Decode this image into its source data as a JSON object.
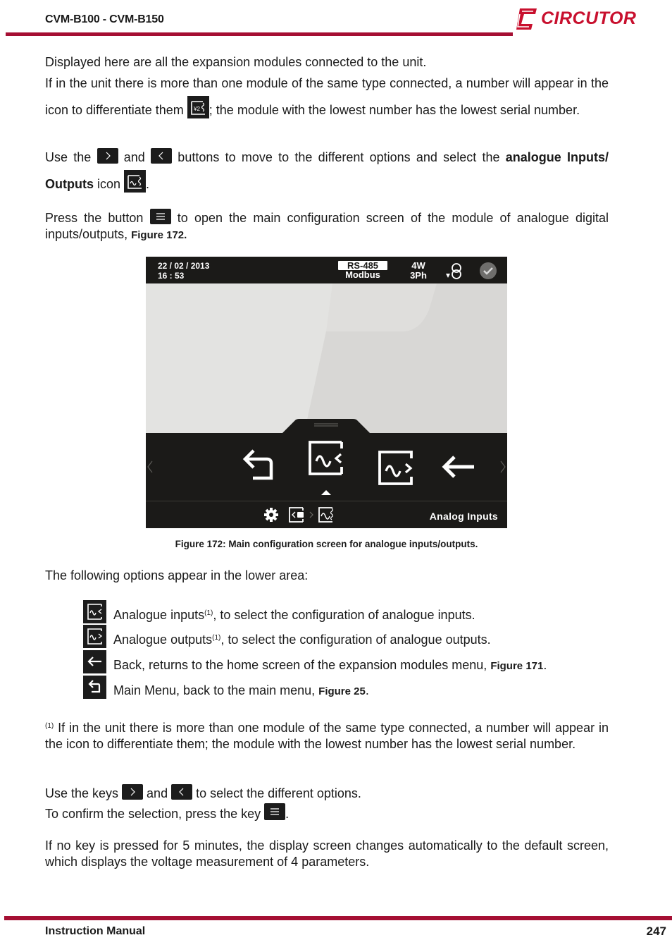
{
  "header": {
    "title": "CVM-B100 - CVM-B150",
    "logo_text": "CIRCUTOR",
    "accent_color": "#a50f33"
  },
  "intro": {
    "line1": "Displayed here are all the expansion modules connected to the unit.",
    "line2_a": "If in the unit there is more than one module of the same type connected, a number will appear in the icon to differentiate them ",
    "line2_icon": "analog-module-numbered-icon",
    "line2_icon_text": "2",
    "line2_b": "; the module with the lowest number has the lowest serial number."
  },
  "nav_para": {
    "a": "Use the ",
    "key_right": "right-key",
    "b": " and ",
    "key_left": "left-key",
    "c": " buttons to move to the different options and select the ",
    "bold": "analogue Inputs/ Outputs",
    "d": " icon ",
    "e": "."
  },
  "press_para": {
    "a": "Press the button ",
    "key": "menu-key",
    "b": " to open the main configuration screen of the module of analogue digital inputs/outputs, ",
    "fig": "Figure 172."
  },
  "device": {
    "date": "22 / 02 / 2013",
    "time": "16 : 53",
    "comm_top": "RS-485",
    "comm_bottom": "Modbus",
    "wiring_top": "4W",
    "wiring_bottom": "3Ph",
    "nav_items": [
      {
        "name": "main-menu",
        "icon": "return-arrow-icon"
      },
      {
        "name": "analog-inputs",
        "icon": "analog-input-icon",
        "selected": true
      },
      {
        "name": "analog-outputs",
        "icon": "analog-output-icon"
      },
      {
        "name": "back",
        "icon": "back-arrow-icon"
      }
    ],
    "bottom_label": "Analog Inputs"
  },
  "figure_caption": "Figure 172: Main configuration screen for analogue inputs/outputs.",
  "options_intro": "The following options appear in the lower area:",
  "options": [
    {
      "icon": "analog-input-icon",
      "label": "Analogue inputs",
      "sup": "(1)",
      "rest": ", to select the configuration of analogue inputs.",
      "fig": "",
      "end": ""
    },
    {
      "icon": "analog-output-icon",
      "label": "Analogue outputs",
      "sup": "(1)",
      "rest": ", to select the configuration of analogue outputs.",
      "fig": "",
      "end": ""
    },
    {
      "icon": "back-arrow-icon",
      "label": "Back, returns to the home screen of the expansion modules menu, ",
      "sup": "",
      "rest": "",
      "fig": "Figure 171",
      "end": "."
    },
    {
      "icon": "return-arrow-icon",
      "label": "Main Menu, back to the main menu, ",
      "sup": "",
      "rest": "",
      "fig": "Figure 25",
      "end": "."
    }
  ],
  "footnote": {
    "mark": "(1)",
    "text": " If in the unit there is more than one module of the same type connected, a number will appear in the icon to differentiate them; the module with the lowest number has the lowest serial number."
  },
  "keys_para": {
    "a": "Use the keys ",
    "b": " and ",
    "c": " to select the different options.",
    "confirm_a": "To confirm the selection, press the key ",
    "confirm_b": "."
  },
  "timeout_para": "If no key is pressed for 5 minutes, the display screen changes automatically to the default screen, which displays the voltage measurement of 4 parameters.",
  "footer": {
    "left": "Instruction Manual",
    "page": "247"
  }
}
